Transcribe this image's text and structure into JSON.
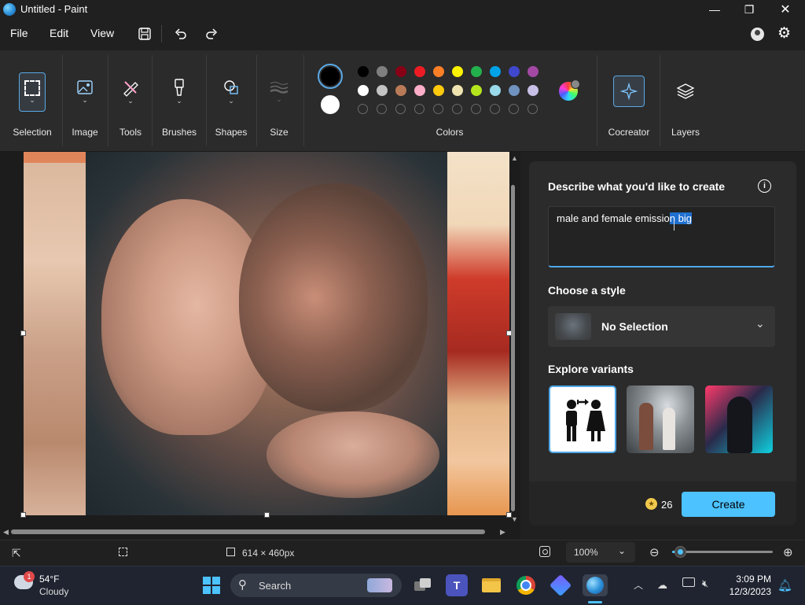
{
  "window": {
    "title": "Untitled - Paint",
    "controls": {
      "minimize": "—",
      "maximize": "❐",
      "close": "✕"
    }
  },
  "menu": {
    "items": [
      "File",
      "Edit",
      "View"
    ]
  },
  "ribbon": {
    "groups": {
      "selection": "Selection",
      "image": "Image",
      "tools": "Tools",
      "brushes": "Brushes",
      "shapes": "Shapes",
      "size": "Size",
      "colors": "Colors",
      "cocreator": "Cocreator",
      "layers": "Layers"
    },
    "color1": "#000000",
    "color2": "#ffffff",
    "palette_row1": [
      "#000000",
      "#7f7f7f",
      "#880015",
      "#ed1c24",
      "#ff7f27",
      "#fff200",
      "#22b14c",
      "#00a2e8",
      "#3f48cc",
      "#a349a4"
    ],
    "palette_row2": [
      "#ffffff",
      "#c3c3c3",
      "#b97a57",
      "#ffaec9",
      "#ffc90e",
      "#efe4b0",
      "#b5e61d",
      "#99d9ea",
      "#7092be",
      "#c8bfe7"
    ],
    "palette_row3_count": 10
  },
  "cocreator": {
    "describe_heading": "Describe what you'd like to create",
    "prompt_plain": "male and female emissio",
    "prompt_selected": "n big",
    "style_heading": "Choose a style",
    "style_value": "No Selection",
    "variants_heading": "Explore variants",
    "credits": "26",
    "create_label": "Create"
  },
  "status": {
    "canvas_size": "614 × 460px",
    "zoom": "100%",
    "zoom_level": 0.08
  },
  "taskbar": {
    "weather_temp": "54°F",
    "weather_desc": "Cloudy",
    "weather_badge": "1",
    "search_label": "Search",
    "time": "3:09 PM",
    "date": "12/3/2023"
  }
}
